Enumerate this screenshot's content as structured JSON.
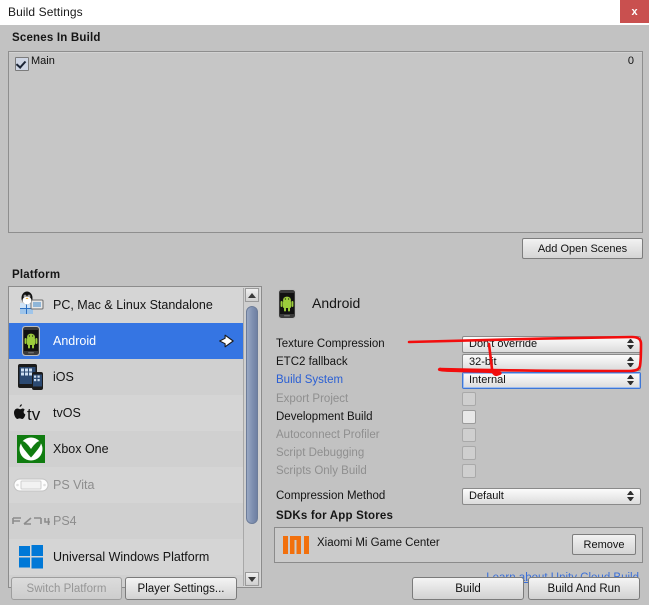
{
  "window": {
    "title": "Build Settings",
    "close_label": "x"
  },
  "scenes": {
    "header": "Scenes In Build",
    "items": [
      {
        "name": "Main",
        "index": "0",
        "checked": true
      }
    ],
    "add_button": "Add Open Scenes"
  },
  "platform": {
    "header": "Platform",
    "items": [
      {
        "label": "PC, Mac & Linux Standalone",
        "icon": "pc-mac-linux-icon",
        "selected": false,
        "disabled": false
      },
      {
        "label": "Android",
        "icon": "android-icon",
        "selected": true,
        "disabled": false
      },
      {
        "label": "iOS",
        "icon": "ios-icon",
        "selected": false,
        "disabled": false
      },
      {
        "label": "tvOS",
        "icon": "tvos-icon",
        "selected": false,
        "disabled": false
      },
      {
        "label": "Xbox One",
        "icon": "xbox-one-icon",
        "selected": false,
        "disabled": false
      },
      {
        "label": "PS Vita",
        "icon": "ps-vita-icon",
        "selected": false,
        "disabled": true
      },
      {
        "label": "PS4",
        "icon": "ps4-icon",
        "selected": false,
        "disabled": true
      },
      {
        "label": "Universal Windows Platform",
        "icon": "windows-icon",
        "selected": false,
        "disabled": false
      },
      {
        "label": "",
        "icon": "html5-icon",
        "selected": false,
        "disabled": false
      }
    ]
  },
  "details": {
    "title": "Android",
    "title_icon": "android-icon",
    "fields": [
      {
        "label": "Texture Compression",
        "type": "dropdown",
        "value": "Don't override",
        "disabled": false,
        "highlighted": false
      },
      {
        "label": "ETC2 fallback",
        "type": "dropdown",
        "value": "32-bit",
        "disabled": false,
        "highlighted": false
      },
      {
        "label": "Build System",
        "type": "dropdown",
        "value": "Internal",
        "disabled": false,
        "highlighted": true,
        "label_style": "link"
      },
      {
        "label": "Export Project",
        "type": "checkbox",
        "checked": false,
        "disabled": true
      },
      {
        "label": "Development Build",
        "type": "checkbox",
        "checked": false,
        "disabled": false
      },
      {
        "label": "Autoconnect Profiler",
        "type": "checkbox",
        "checked": false,
        "disabled": true
      },
      {
        "label": "Script Debugging",
        "type": "checkbox",
        "checked": false,
        "disabled": true
      },
      {
        "label": "Scripts Only Build",
        "type": "checkbox",
        "checked": false,
        "disabled": true
      },
      {
        "label": "Compression Method",
        "type": "dropdown",
        "value": "Default",
        "disabled": false,
        "highlighted": false
      }
    ],
    "sdk_header": "SDKs for App Stores",
    "sdk_item": {
      "name": "Xiaomi Mi Game Center",
      "icon": "xiaomi-icon",
      "remove_label": "Remove"
    },
    "cloud_link": "Learn about Unity Cloud Build"
  },
  "footer": {
    "switch_platform": "Switch Platform",
    "player_settings": "Player Settings...",
    "build": "Build",
    "build_and_run": "Build And Run"
  },
  "colors": {
    "selection": "#3575e3",
    "link": "#2a5fd4",
    "annotation": "#f20d0d",
    "close": "#c9504f",
    "xiaomi": "#f2700d"
  },
  "annotation": {
    "type": "hand-drawn-highlight",
    "target": "Build System dropdown"
  }
}
